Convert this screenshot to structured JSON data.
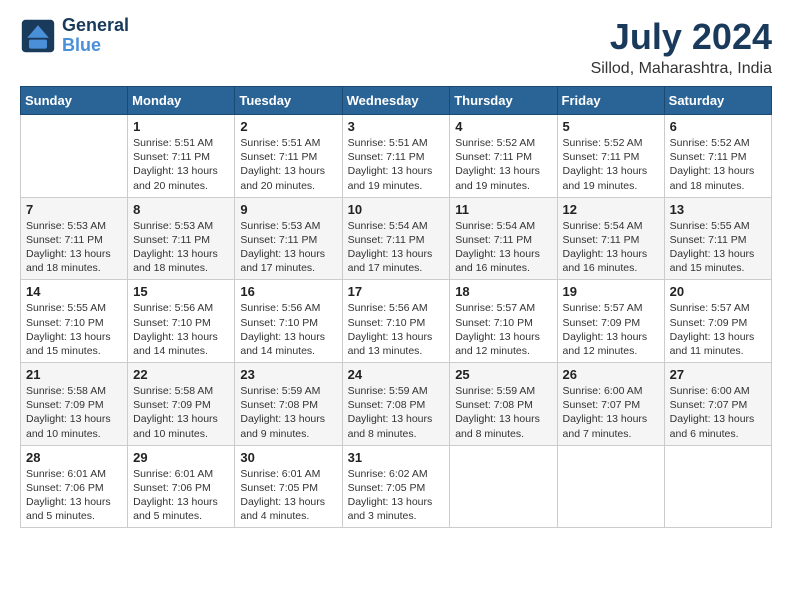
{
  "header": {
    "logo_line1": "General",
    "logo_line2": "Blue",
    "month": "July 2024",
    "location": "Sillod, Maharashtra, India"
  },
  "days_of_week": [
    "Sunday",
    "Monday",
    "Tuesday",
    "Wednesday",
    "Thursday",
    "Friday",
    "Saturday"
  ],
  "weeks": [
    [
      {
        "day": "",
        "sunrise": "",
        "sunset": "",
        "daylight": ""
      },
      {
        "day": "1",
        "sunrise": "5:51 AM",
        "sunset": "7:11 PM",
        "daylight": "13 hours and 20 minutes."
      },
      {
        "day": "2",
        "sunrise": "5:51 AM",
        "sunset": "7:11 PM",
        "daylight": "13 hours and 20 minutes."
      },
      {
        "day": "3",
        "sunrise": "5:51 AM",
        "sunset": "7:11 PM",
        "daylight": "13 hours and 19 minutes."
      },
      {
        "day": "4",
        "sunrise": "5:52 AM",
        "sunset": "7:11 PM",
        "daylight": "13 hours and 19 minutes."
      },
      {
        "day": "5",
        "sunrise": "5:52 AM",
        "sunset": "7:11 PM",
        "daylight": "13 hours and 19 minutes."
      },
      {
        "day": "6",
        "sunrise": "5:52 AM",
        "sunset": "7:11 PM",
        "daylight": "13 hours and 18 minutes."
      }
    ],
    [
      {
        "day": "7",
        "sunrise": "5:53 AM",
        "sunset": "7:11 PM",
        "daylight": "13 hours and 18 minutes."
      },
      {
        "day": "8",
        "sunrise": "5:53 AM",
        "sunset": "7:11 PM",
        "daylight": "13 hours and 18 minutes."
      },
      {
        "day": "9",
        "sunrise": "5:53 AM",
        "sunset": "7:11 PM",
        "daylight": "13 hours and 17 minutes."
      },
      {
        "day": "10",
        "sunrise": "5:54 AM",
        "sunset": "7:11 PM",
        "daylight": "13 hours and 17 minutes."
      },
      {
        "day": "11",
        "sunrise": "5:54 AM",
        "sunset": "7:11 PM",
        "daylight": "13 hours and 16 minutes."
      },
      {
        "day": "12",
        "sunrise": "5:54 AM",
        "sunset": "7:11 PM",
        "daylight": "13 hours and 16 minutes."
      },
      {
        "day": "13",
        "sunrise": "5:55 AM",
        "sunset": "7:11 PM",
        "daylight": "13 hours and 15 minutes."
      }
    ],
    [
      {
        "day": "14",
        "sunrise": "5:55 AM",
        "sunset": "7:10 PM",
        "daylight": "13 hours and 15 minutes."
      },
      {
        "day": "15",
        "sunrise": "5:56 AM",
        "sunset": "7:10 PM",
        "daylight": "13 hours and 14 minutes."
      },
      {
        "day": "16",
        "sunrise": "5:56 AM",
        "sunset": "7:10 PM",
        "daylight": "13 hours and 14 minutes."
      },
      {
        "day": "17",
        "sunrise": "5:56 AM",
        "sunset": "7:10 PM",
        "daylight": "13 hours and 13 minutes."
      },
      {
        "day": "18",
        "sunrise": "5:57 AM",
        "sunset": "7:10 PM",
        "daylight": "13 hours and 12 minutes."
      },
      {
        "day": "19",
        "sunrise": "5:57 AM",
        "sunset": "7:09 PM",
        "daylight": "13 hours and 12 minutes."
      },
      {
        "day": "20",
        "sunrise": "5:57 AM",
        "sunset": "7:09 PM",
        "daylight": "13 hours and 11 minutes."
      }
    ],
    [
      {
        "day": "21",
        "sunrise": "5:58 AM",
        "sunset": "7:09 PM",
        "daylight": "13 hours and 10 minutes."
      },
      {
        "day": "22",
        "sunrise": "5:58 AM",
        "sunset": "7:09 PM",
        "daylight": "13 hours and 10 minutes."
      },
      {
        "day": "23",
        "sunrise": "5:59 AM",
        "sunset": "7:08 PM",
        "daylight": "13 hours and 9 minutes."
      },
      {
        "day": "24",
        "sunrise": "5:59 AM",
        "sunset": "7:08 PM",
        "daylight": "13 hours and 8 minutes."
      },
      {
        "day": "25",
        "sunrise": "5:59 AM",
        "sunset": "7:08 PM",
        "daylight": "13 hours and 8 minutes."
      },
      {
        "day": "26",
        "sunrise": "6:00 AM",
        "sunset": "7:07 PM",
        "daylight": "13 hours and 7 minutes."
      },
      {
        "day": "27",
        "sunrise": "6:00 AM",
        "sunset": "7:07 PM",
        "daylight": "13 hours and 6 minutes."
      }
    ],
    [
      {
        "day": "28",
        "sunrise": "6:01 AM",
        "sunset": "7:06 PM",
        "daylight": "13 hours and 5 minutes."
      },
      {
        "day": "29",
        "sunrise": "6:01 AM",
        "sunset": "7:06 PM",
        "daylight": "13 hours and 5 minutes."
      },
      {
        "day": "30",
        "sunrise": "6:01 AM",
        "sunset": "7:05 PM",
        "daylight": "13 hours and 4 minutes."
      },
      {
        "day": "31",
        "sunrise": "6:02 AM",
        "sunset": "7:05 PM",
        "daylight": "13 hours and 3 minutes."
      },
      {
        "day": "",
        "sunrise": "",
        "sunset": "",
        "daylight": ""
      },
      {
        "day": "",
        "sunrise": "",
        "sunset": "",
        "daylight": ""
      },
      {
        "day": "",
        "sunrise": "",
        "sunset": "",
        "daylight": ""
      }
    ]
  ],
  "labels": {
    "sunrise": "Sunrise:",
    "sunset": "Sunset:",
    "daylight": "Daylight:"
  }
}
